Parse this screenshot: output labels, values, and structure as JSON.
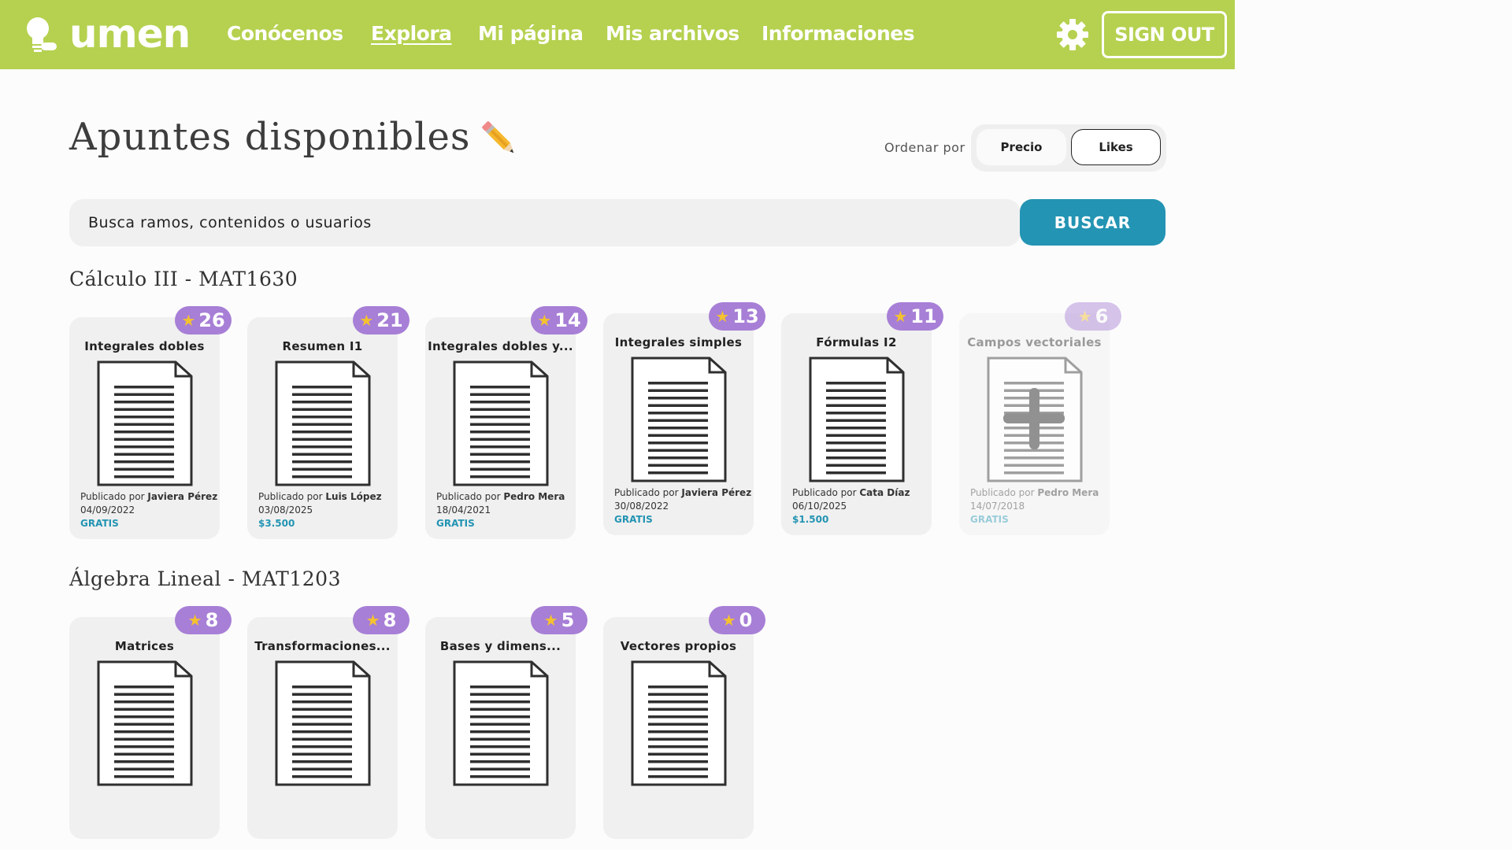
{
  "nav": {
    "logo": "lumen",
    "links": [
      "Conócenos",
      "Explora",
      "Mi página",
      "Mis archivos",
      "Informaciones"
    ],
    "signout": "SIGN OUT"
  },
  "header": {
    "title": "Apuntes disponibles",
    "sort_label": "Ordenar por",
    "sort_options": [
      "Precio",
      "Likes"
    ],
    "sort_selected": "Likes"
  },
  "search": {
    "placeholder": "Busca ramos, contenidos o usuarios",
    "button": "BUSCAR"
  },
  "sections": [
    {
      "title": "Cálculo III - MAT1630",
      "cards": [
        {
          "title": "Integrales dobles",
          "likes": "26",
          "published_prefix": "Publicado por",
          "author": "Javiera Pérez",
          "date": "04/09/2022",
          "price": "GRATIS"
        },
        {
          "title": "Resumen I1",
          "likes": "21",
          "published_prefix": "Publicado por",
          "author": "Luis López",
          "date": "03/08/2025",
          "price": "$3.500"
        },
        {
          "title": "Integrales dobles y...",
          "likes": "14",
          "published_prefix": "Publicado por",
          "author": "Pedro Mera",
          "date": "18/04/2021",
          "price": "GRATIS"
        },
        {
          "title": "Integrales simples",
          "likes": "13",
          "published_prefix": "Publicado por",
          "author": "Javiera Pérez",
          "date": "30/08/2022",
          "price": "GRATIS"
        },
        {
          "title": "Fórmulas I2",
          "likes": "11",
          "published_prefix": "Publicado por",
          "author": "Cata Díaz",
          "date": "06/10/2025",
          "price": "$1.500"
        },
        {
          "title": "Campos vectoriales",
          "likes": "6",
          "published_prefix": "Publicado por",
          "author": "Pedro Mera",
          "date": "14/07/2018",
          "price": "GRATIS"
        }
      ]
    },
    {
      "title": "Álgebra Lineal - MAT1203",
      "cards": [
        {
          "title": "Matrices",
          "likes": "8"
        },
        {
          "title": "Transformaciones...",
          "likes": "8"
        },
        {
          "title": "Bases y dimens...",
          "likes": "5"
        },
        {
          "title": "Vectores propios",
          "likes": "0"
        }
      ]
    }
  ],
  "colors": {
    "nav_bg": "#b5d14f",
    "badge": "#a77fd6",
    "accent": "#2394b3",
    "star": "#f5c22f"
  },
  "icons": [
    "lightbulb-logo-icon",
    "gear-icon",
    "pencil-icon",
    "star-icon",
    "document-icon",
    "plus-icon"
  ]
}
